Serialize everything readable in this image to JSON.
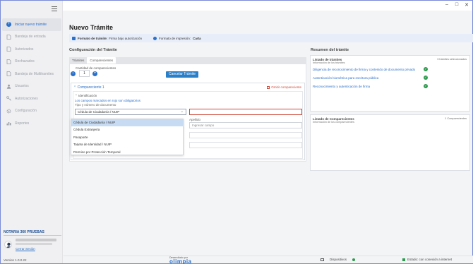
{
  "window": {
    "minimize": "–",
    "maximize": "□",
    "close": "✕"
  },
  "sidebar": {
    "items": [
      {
        "label": "Iniciar nuevo trámite",
        "icon": "plus-circle-icon",
        "active": true
      },
      {
        "label": "Bandeja de entrada",
        "icon": "document-icon"
      },
      {
        "label": "Autorizados",
        "icon": "document-icon"
      },
      {
        "label": "Rechazados",
        "icon": "document-icon"
      },
      {
        "label": "Bandeja de Multitramites",
        "icon": "document-icon"
      },
      {
        "label": "Usuarios",
        "icon": "user-icon"
      },
      {
        "label": "Autorizaciones",
        "icon": "key-icon"
      },
      {
        "label": "Configuración",
        "icon": "gear-icon"
      },
      {
        "label": "Reportes",
        "icon": "bar-chart-icon"
      }
    ],
    "org": "NOTARIA 360 PRUEBAS",
    "logout": "Cerrar Sesión",
    "version": "Version 1.0.0.22"
  },
  "main": {
    "title": "Nuevo Trámite",
    "info": {
      "format_label": "Formato de trámite:",
      "format_value": "Firma bajo autorización",
      "print_label": "Formato de impresión:",
      "print_value": "Carta"
    },
    "config_title": "Configuración del Trámite",
    "tabs": [
      {
        "label": "Trámites"
      },
      {
        "label": "Comparecientes"
      }
    ],
    "qty_label": "Cantidad de comparecientes",
    "qty_minus": "−",
    "qty_value": "1",
    "qty_plus": "+",
    "cancel_label": "Cancelar Trámite",
    "comp_header": "Compareciente 1",
    "delete_label": "Omitir compareciente",
    "ident_title": "Identificación",
    "required_note": "Los campos marcados en rojo son obligatorios",
    "doctype_label": "Tipo y número de documento",
    "doctype_value": "Cédula de Ciudadanía / NUIP",
    "apellido_label": "Apellido",
    "apellido_placeholder": "Ingresar campo",
    "dropdown_options": [
      "Cédula de Ciudadanía / NUIP",
      "Cédula Extranjería",
      "Pasaporte",
      "Tarjeta de Identidad / NUIP",
      "Permiso por Protección Temporal"
    ]
  },
  "summary": {
    "title": "Resumen del trámite",
    "tramites": {
      "title": "Listado de trámites",
      "subtitle": "Información de los trámites",
      "count": "3 trámites seleccionados",
      "rows": [
        "Diligencia de reconocimiento de firma y contenido de documento privado",
        "Autenticación biométrica para escritura pública",
        "Reconocimiento y autenticación de firma"
      ]
    },
    "comparecientes": {
      "title": "Listado de Comparecientes",
      "subtitle": "Información de los comparecientes",
      "count": "1 Comparecientes"
    }
  },
  "footer": {
    "dev_label": "Desarrollado por",
    "logo": "olimpia",
    "devices": "Dispositivos",
    "connection": "Estado: con conexión a internet"
  }
}
